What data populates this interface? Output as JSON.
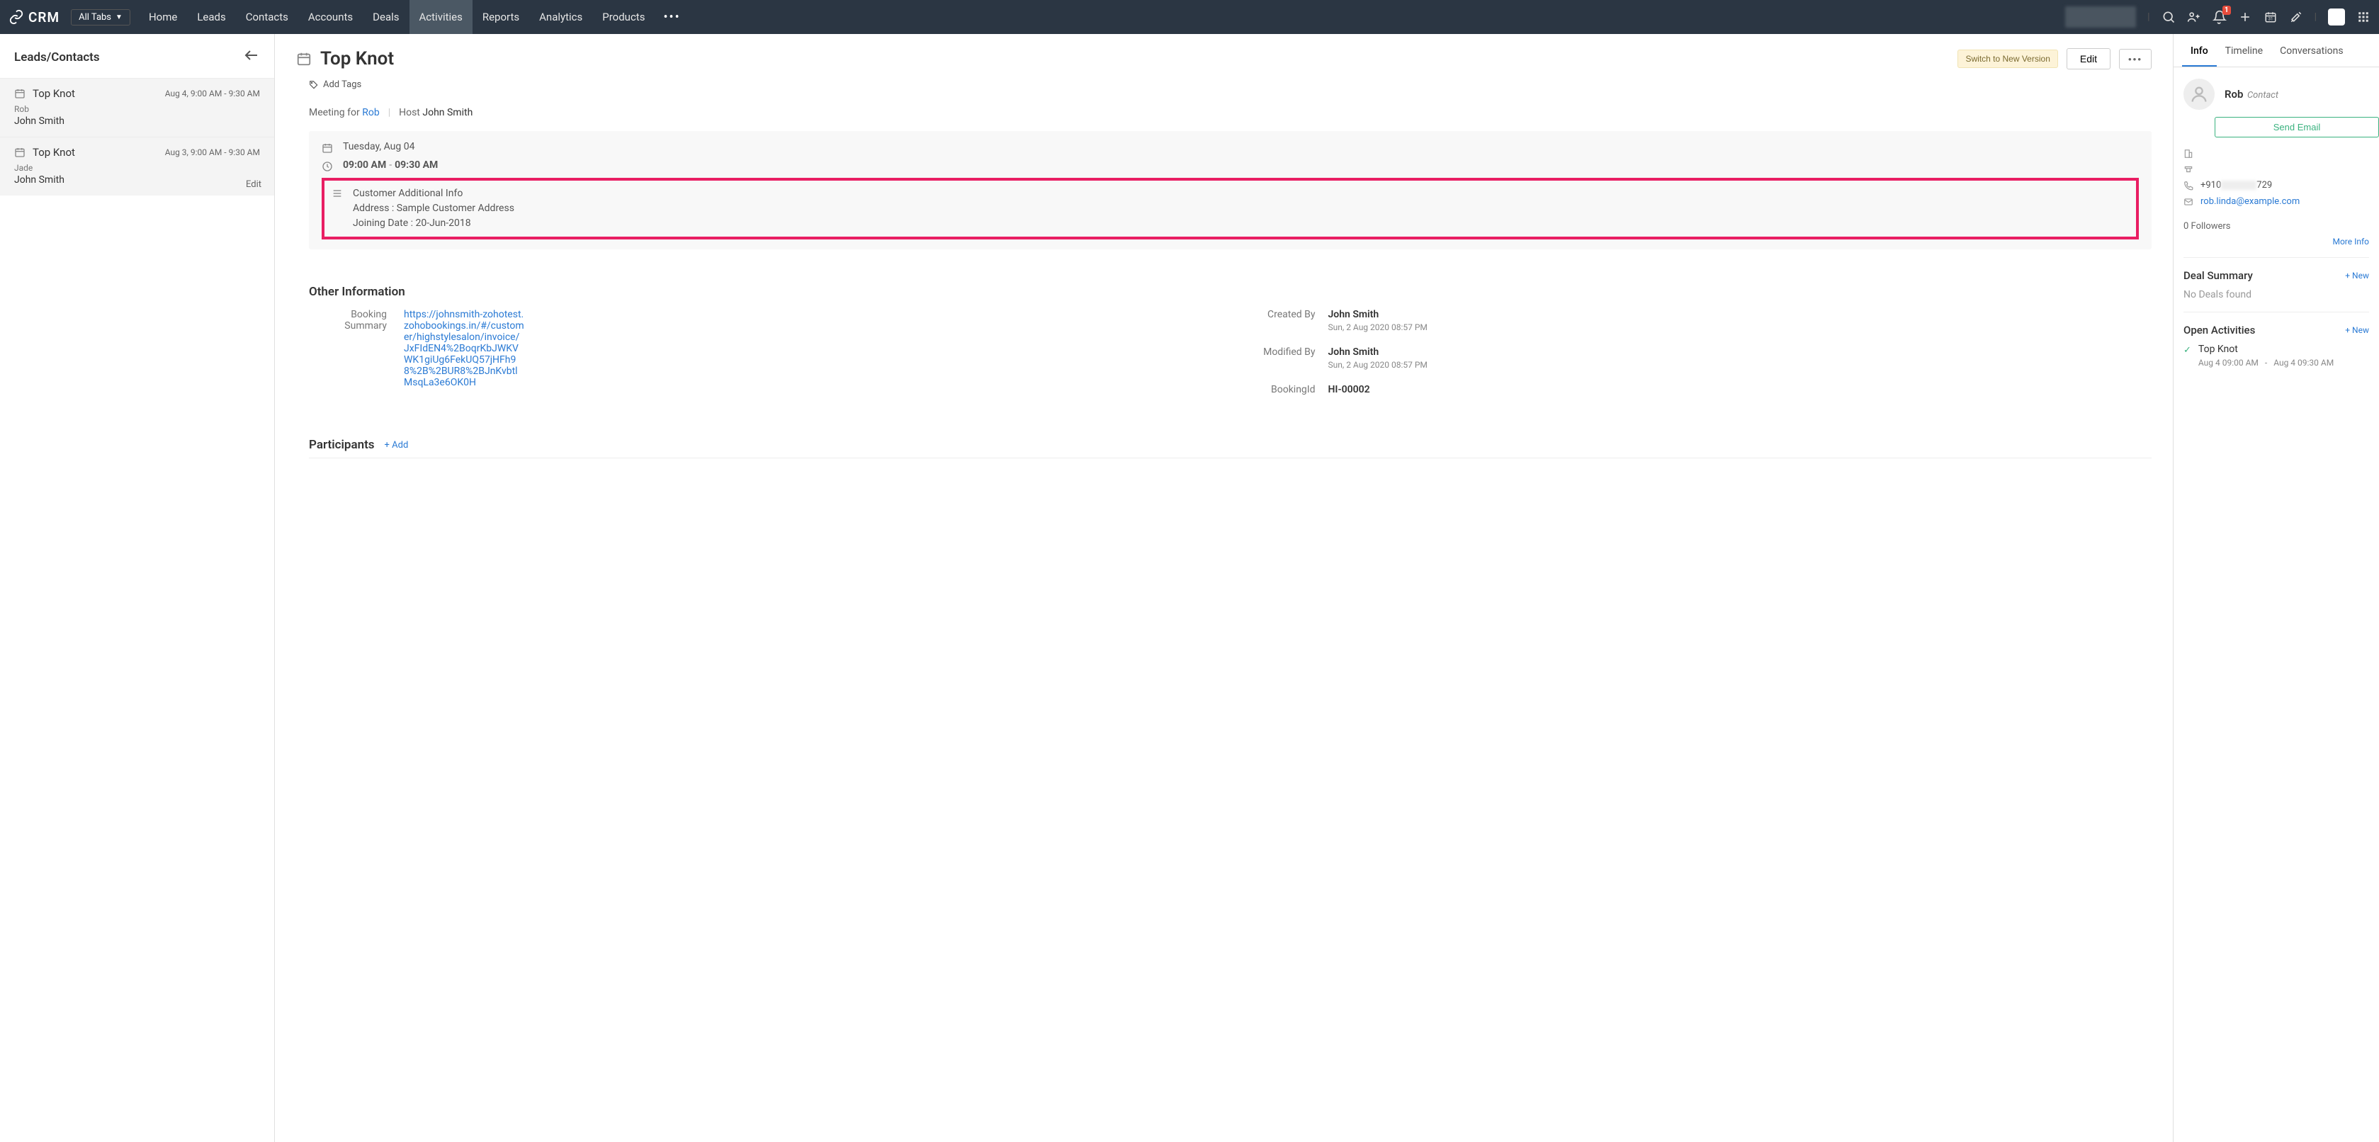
{
  "topbar": {
    "brand": "CRM",
    "allTabs": "All Tabs",
    "nav": [
      "Home",
      "Leads",
      "Contacts",
      "Accounts",
      "Deals",
      "Activities",
      "Reports",
      "Analytics",
      "Products"
    ],
    "activeNav": "Activities",
    "notifCount": "1"
  },
  "leftCol": {
    "heading": "Leads/Contacts",
    "items": [
      {
        "title": "Top Knot",
        "time": "Aug 4, 9:00 AM - 9:30 AM",
        "sub1": "Rob",
        "sub2": "John Smith"
      },
      {
        "title": "Top Knot",
        "time": "Aug 3, 9:00 AM - 9:30 AM",
        "sub1": "Jade",
        "sub2": "John Smith"
      }
    ],
    "editLabel": "Edit"
  },
  "middle": {
    "title": "Top Knot",
    "switchBtn": "Switch to New Version",
    "editBtn": "Edit",
    "addTags": "Add Tags",
    "meetingForLabel": "Meeting for",
    "meetingForName": "Rob",
    "hostLabel": "Host",
    "hostName": "John Smith",
    "dateLine": "Tuesday, Aug 04",
    "timeStart": "09:00 AM",
    "timeEnd": "09:30 AM",
    "addlInfoTitle": "Customer Additional Info",
    "addlAddress": "Address : Sample Customer Address",
    "addlJoining": "Joining Date : 20-Jun-2018",
    "otherInfoHeading": "Other Information",
    "bookingSummaryLabel": "Booking Summary",
    "bookingUrl": "https://johnsmith-zohotest.zohobookings.in/#/customer/highstylesalon/invoice/JxFIdEN4%2BoqrKbJWKVWK1giUg6FekUQ57jHFh98%2B%2BUR8%2BJnKvbtlMsqLa3e6OK0H",
    "createdByLabel": "Created By",
    "createdByName": "John Smith",
    "createdByDate": "Sun, 2 Aug 2020 08:57 PM",
    "modifiedByLabel": "Modified By",
    "modifiedByName": "John Smith",
    "modifiedByDate": "Sun, 2 Aug 2020 08:57 PM",
    "bookingIdLabel": "BookingId",
    "bookingIdValue": "HI-00002",
    "participantsHeading": "Participants",
    "addParticipant": "+ Add"
  },
  "right": {
    "tabs": [
      "Info",
      "Timeline",
      "Conversations"
    ],
    "activeTab": "Info",
    "contactName": "Rob",
    "contactType": "Contact",
    "sendEmail": "Send Email",
    "phonePrefix": "+910",
    "phoneSuffix": "729",
    "email": "rob.linda@example.com",
    "followers": "0 Followers",
    "moreInfo": "More Info",
    "dealHeading": "Deal Summary",
    "newLabel": "+ New",
    "noDeals": "No Deals found",
    "openActHeading": "Open Activities",
    "activityTitle": "Top Knot",
    "activityStart": "Aug 4 09:00 AM",
    "activityEnd": "Aug 4 09:30 AM"
  }
}
